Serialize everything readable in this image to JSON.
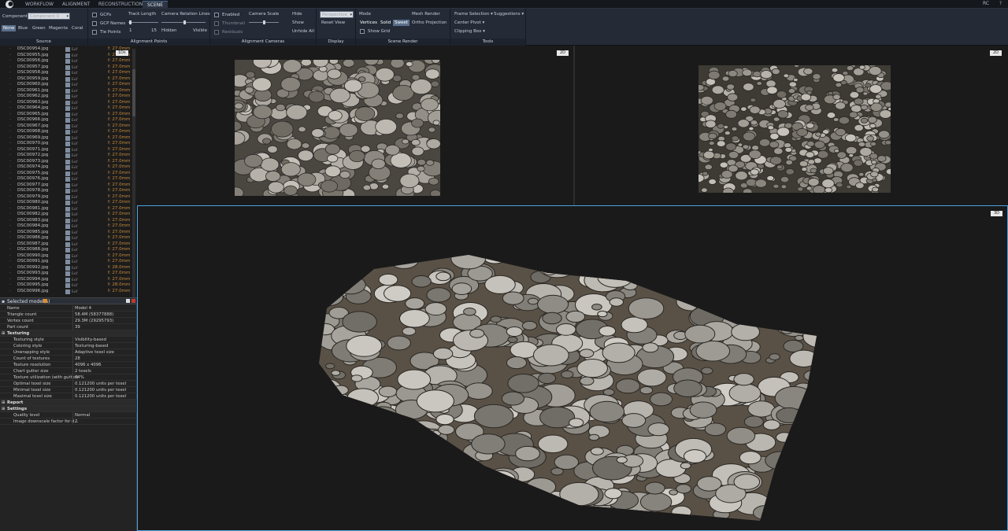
{
  "menubar": {
    "tabs": [
      {
        "label": "WORKFLOW"
      },
      {
        "label": "ALIGNMENT"
      },
      {
        "label": "RECONSTRUCTION"
      },
      {
        "label": "SCENE"
      }
    ],
    "user": "RC",
    "help_icon": "help-icon"
  },
  "ribbon": {
    "source": {
      "component_label": "Component",
      "component_value": "Component 0",
      "colors": [
        "None",
        "Blue",
        "Green",
        "Magenta",
        "Coral"
      ],
      "footer": "Source"
    },
    "alignment_points": {
      "gcps": "GCPs",
      "gcp_names": "GCP Names",
      "tie_points": "Tie Points",
      "track_length": "Track Length",
      "track_min": "1",
      "track_max": "15",
      "camera_relation_lines": "Camera Relation Lines",
      "hidden": "Hidden",
      "visible": "Visible",
      "footer": "Alignment Points"
    },
    "alignment_cameras": {
      "enabled": "Enabled",
      "thumbnail": "Thumbnail",
      "residuals": "Residuals",
      "camera_scale": "Camera Scale",
      "hide": "Hide",
      "show": "Show",
      "unhide_all": "Unhide All",
      "footer": "Alignment Cameras"
    },
    "display": {
      "projection": "Perspective",
      "reset_view": "Reset View",
      "footer": "Display"
    },
    "scene_render": {
      "mode": "Mode",
      "vertices": "Vertices",
      "solid": "Solid",
      "sweet": "Sweet",
      "show_grid": "Show Grid",
      "mesh_render": "Mesh Render",
      "ortho_projection": "Ortho Projection",
      "footer": "Scene Render"
    },
    "tools": {
      "frame_selection": "Frame Selection",
      "suggestions": "Suggestions",
      "center_pivot": "Center Pivot",
      "clipping_box": "Clipping Box",
      "footer": "Tools"
    }
  },
  "image_list": {
    "header_tag": "1Ds",
    "ext": "Exif",
    "items": [
      {
        "name": "DSC00954.jpg",
        "focal": "f: 27.0mm"
      },
      {
        "name": "DSC00955.jpg",
        "focal": "f: 27.0mm"
      },
      {
        "name": "DSC00956.jpg",
        "focal": "f: 27.0mm"
      },
      {
        "name": "DSC00957.jpg",
        "focal": "f: 27.0mm"
      },
      {
        "name": "DSC00958.jpg",
        "focal": "f: 27.0mm"
      },
      {
        "name": "DSC00959.jpg",
        "focal": "f: 27.0mm"
      },
      {
        "name": "DSC00960.jpg",
        "focal": "f: 27.0mm"
      },
      {
        "name": "DSC00961.jpg",
        "focal": "f: 27.0mm"
      },
      {
        "name": "DSC00962.jpg",
        "focal": "f: 27.0mm"
      },
      {
        "name": "DSC00963.jpg",
        "focal": "f: 27.0mm"
      },
      {
        "name": "DSC00964.jpg",
        "focal": "f: 27.0mm"
      },
      {
        "name": "DSC00965.jpg",
        "focal": "f: 27.0mm"
      },
      {
        "name": "DSC00966.jpg",
        "focal": "f: 27.0mm"
      },
      {
        "name": "DSC00967.jpg",
        "focal": "f: 27.0mm"
      },
      {
        "name": "DSC00968.jpg",
        "focal": "f: 27.0mm"
      },
      {
        "name": "DSC00969.jpg",
        "focal": "f: 27.0mm"
      },
      {
        "name": "DSC00970.jpg",
        "focal": "f: 27.0mm"
      },
      {
        "name": "DSC00971.jpg",
        "focal": "f: 27.0mm"
      },
      {
        "name": "DSC00972.jpg",
        "focal": "f: 27.0mm"
      },
      {
        "name": "DSC00973.jpg",
        "focal": "f: 27.0mm"
      },
      {
        "name": "DSC00974.jpg",
        "focal": "f: 27.0mm"
      },
      {
        "name": "DSC00975.jpg",
        "focal": "f: 27.0mm"
      },
      {
        "name": "DSC00976.jpg",
        "focal": "f: 27.0mm"
      },
      {
        "name": "DSC00977.jpg",
        "focal": "f: 27.0mm"
      },
      {
        "name": "DSC00978.jpg",
        "focal": "f: 27.0mm"
      },
      {
        "name": "DSC00979.jpg",
        "focal": "f: 27.0mm"
      },
      {
        "name": "DSC00980.jpg",
        "focal": "f: 27.0mm"
      },
      {
        "name": "DSC00981.jpg",
        "focal": "f: 27.0mm"
      },
      {
        "name": "DSC00982.jpg",
        "focal": "f: 27.0mm"
      },
      {
        "name": "DSC00983.jpg",
        "focal": "f: 27.0mm"
      },
      {
        "name": "DSC00984.jpg",
        "focal": "f: 27.0mm"
      },
      {
        "name": "DSC00985.jpg",
        "focal": "f: 27.0mm"
      },
      {
        "name": "DSC00986.jpg",
        "focal": "f: 27.0mm"
      },
      {
        "name": "DSC00987.jpg",
        "focal": "f: 27.0mm"
      },
      {
        "name": "DSC00988.jpg",
        "focal": "f: 27.0mm"
      },
      {
        "name": "DSC00990.jpg",
        "focal": "f: 27.0mm"
      },
      {
        "name": "DSC00991.jpg",
        "focal": "f: 27.0mm"
      },
      {
        "name": "DSC00992.jpg",
        "focal": "f: 28.0mm"
      },
      {
        "name": "DSC00993.jpg",
        "focal": "f: 27.0mm"
      },
      {
        "name": "DSC00994.jpg",
        "focal": "f: 27.0mm"
      },
      {
        "name": "DSC00995.jpg",
        "focal": "f: 28.0mm"
      },
      {
        "name": "DSC00996.jpg",
        "focal": "f: 27.0mm"
      }
    ]
  },
  "selected_models": {
    "title": "Selected model(s)",
    "rows": [
      {
        "k": "Name",
        "v": "Model 4"
      },
      {
        "k": "Triangle count",
        "v": "58.4M (58377888)"
      },
      {
        "k": "Vertex count",
        "v": "29.3M (29295793)"
      },
      {
        "k": "Part count",
        "v": "39"
      }
    ],
    "texturing_title": "Texturing",
    "texturing": [
      {
        "k": "Texturing style",
        "v": "Visibility-based"
      },
      {
        "k": "Coloring style",
        "v": "Texturing-based"
      },
      {
        "k": "Unwrapping style",
        "v": "Adaptive texel size"
      },
      {
        "k": "Count of textures",
        "v": "28"
      },
      {
        "k": "Texture resolution",
        "v": "4096 x 4096"
      },
      {
        "k": "Chart gutter size",
        "v": "2 texels"
      },
      {
        "k": "Texture utilization (with gutter)",
        "v": "94%"
      },
      {
        "k": "Optimal texel size",
        "v": "0.121200 units per texel"
      },
      {
        "k": "Minimal texel size",
        "v": "0.121200 units per texel"
      },
      {
        "k": "Maximal texel size",
        "v": "0.121200 units per texel"
      }
    ],
    "report_title": "Report",
    "settings_title": "Settings",
    "settings": [
      {
        "k": "Quality level",
        "v": "Normal"
      },
      {
        "k": "Image downscale factor for d...",
        "v": "2"
      }
    ]
  },
  "viewports": {
    "top_left_tag": "2D",
    "top_right_tag": "2D",
    "bottom_tag": "3D"
  }
}
